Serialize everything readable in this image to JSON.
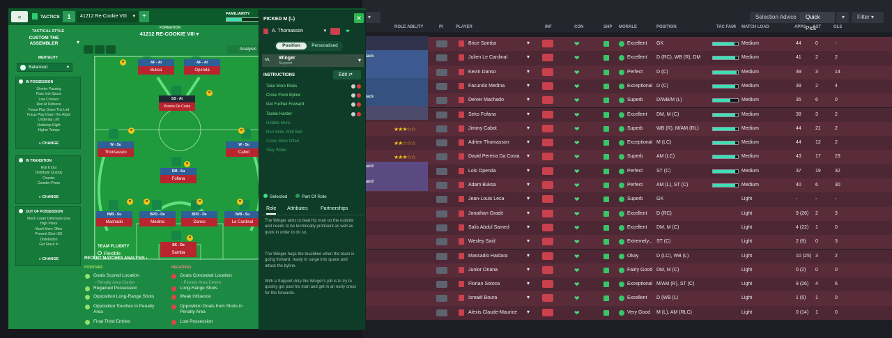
{
  "header": {
    "tactics_label": "TACTICS",
    "slot_number": "1",
    "tactic_name": "41212 Re-Cookie VIII",
    "add_label": "+",
    "familiarity_label": "FAMILIARITY"
  },
  "left_sidebar": {
    "tactical_style_label": "TACTICAL STYLE",
    "tactical_style_value": "CUSTOM THE ASSEMBLER",
    "mentality_label": "MENTALITY",
    "mentality_value": "Balanced",
    "in_possession": {
      "title": "IN POSSESSION",
      "items": [
        "Shorter Passing",
        "Pass Into Space",
        "Low Crosses",
        "Run At Defence",
        "Focus Play Down The Left",
        "Focus Play Down The Right",
        "Underlap Left",
        "Underlap Right",
        "Higher Tempo"
      ],
      "change": "CHANGE"
    },
    "in_transition": {
      "title": "IN TRANSITION",
      "items": [
        "Roll It Out",
        "Distribute Quickly",
        "Counter",
        "Counter-Press"
      ],
      "change": "CHANGE"
    },
    "out_of_possession": {
      "title": "OUT OF POSSESSION",
      "items": [
        "Much Lower Defensive Line",
        "High Press",
        "Much More Often",
        "Prevent Short GK",
        "Distribution",
        "Get Stuck In"
      ],
      "change": "CHANGE"
    }
  },
  "formation": {
    "label": "FORMATION",
    "name": "41212 RE-COOKIE VIII",
    "analysis": "Analysis",
    "team_fluidity_label": "TEAM FLUIDITY",
    "team_fluidity_value": "Flexible",
    "players": [
      {
        "role": "AF - At",
        "name": "Buksa"
      },
      {
        "role": "AF - At",
        "name": "Openda"
      },
      {
        "role": "SS - At",
        "name": "Pereira Da Costa"
      },
      {
        "role": "W - Su",
        "name": "Thomasson"
      },
      {
        "role": "W - Su",
        "name": "Cabot"
      },
      {
        "role": "DM - Su",
        "name": "Fofana"
      },
      {
        "role": "IWB - Su",
        "name": "Machado"
      },
      {
        "role": "BPD - De",
        "name": "Medina"
      },
      {
        "role": "BPD - De",
        "name": "Danso"
      },
      {
        "role": "IWB - Su",
        "name": "Le Cardinal"
      },
      {
        "role": "SK - De",
        "name": "Samba"
      }
    ]
  },
  "analysis": {
    "title": "RECENT MATCHES ANALYSIS",
    "positives_label": "POSITIVES",
    "negatives_label": "NEGATIVES",
    "positives": [
      "Goals Scored Location",
      "- Penalty Area Centre",
      "Regained Possession",
      "Opposition Long-Range Shots",
      "Opposition Touches in Penalty Area",
      "Final Third Entries"
    ],
    "negatives": [
      "Goals Conceded Location",
      "- Penalty Area Centre",
      "Long-Range Shots",
      "Weak Influence",
      "Opposition Goals from Shots in Penalty Area",
      "Lost Possession"
    ]
  },
  "popup": {
    "title": "PICKED M (L)",
    "player": "A. Thomasson",
    "tab_position": "Position",
    "tab_personalised": "Personalised",
    "position_code": "ML",
    "role": "Winger",
    "duty": "Support",
    "instructions_label": "INSTRUCTIONS",
    "edit_label": "Edit",
    "instructions_on": [
      "Take More Risks",
      "Cross From Byline",
      "Get Further Forward",
      "Tackle Harder"
    ],
    "instructions_off": [
      "Dribble More",
      "Run Wide With Ball",
      "Cross More Often",
      "Stay Wider"
    ],
    "legend_selected": "Selected",
    "legend_part": "Part Of Role",
    "tabs": [
      "Role",
      "Attributes",
      "Partnerships"
    ],
    "desc": [
      "The Winger aims to beat his man on the outside and needs to be technically proficient as well as quick in order to do so.",
      "The Winger hugs the touchline when the team is going forward, ready to surge into space and attack the byline.",
      "With a Support duty the Winger's job is to try to quickly get past his man and get in an early cross for the forwards."
    ]
  },
  "squad": {
    "selection_advice": "Selection Advice",
    "quick_pick": "Quick Pick",
    "filter": "Filter",
    "columns": [
      "ROLE ABILITY",
      "PI",
      "PLAYER",
      "INF",
      "CON",
      "SHP",
      "MORALE",
      "POSITION",
      "TAC FAMI",
      "MATCH LOAD",
      "APPS",
      "AST",
      "GLS"
    ],
    "side_labels": [
      "r",
      "Back",
      "Back",
      "ward",
      "ward"
    ],
    "rows": [
      {
        "name": "Brice Samba",
        "morale": "Excellent",
        "pos": "GK",
        "load": "Medium",
        "apps": "44",
        "ast": "0",
        "gls": "-",
        "stars": 3,
        "fam": 0.85,
        "starter": true
      },
      {
        "name": "Julien Le Cardinal",
        "morale": "Excellent",
        "pos": "D (RC), WB (R), DM",
        "load": "Medium",
        "apps": "41",
        "ast": "2",
        "gls": "2",
        "stars": 2,
        "fam": 0.9,
        "starter": true
      },
      {
        "name": "Kevin Danso",
        "morale": "Perfect",
        "pos": "D (C)",
        "load": "Medium",
        "apps": "39",
        "ast": "3",
        "gls": "14",
        "stars": 3,
        "fam": 0.95,
        "starter": true
      },
      {
        "name": "Facundo Medina",
        "morale": "Exceptional",
        "pos": "D (C)",
        "load": "Medium",
        "apps": "39",
        "ast": "2",
        "gls": "4",
        "stars": 3,
        "fam": 0.9,
        "starter": true
      },
      {
        "name": "Deiver Machado",
        "morale": "Superb",
        "pos": "D/WB/M (L)",
        "load": "Medium",
        "apps": "35",
        "ast": "6",
        "gls": "0",
        "stars": 2,
        "fam": 0.7,
        "starter": true
      },
      {
        "name": "Seko Fofana",
        "morale": "Excellent",
        "pos": "DM, M (C)",
        "load": "Medium",
        "apps": "38",
        "ast": "3",
        "gls": "2",
        "stars": 2,
        "fam": 0.9,
        "starter": true
      },
      {
        "name": "Jimmy Cabot",
        "morale": "Superb",
        "pos": "WB (R), M/AM (RL)",
        "load": "Medium",
        "apps": "44",
        "ast": "21",
        "gls": "2",
        "stars": 3,
        "fam": 0.9,
        "starter": true
      },
      {
        "name": "Adrien Thomasson",
        "morale": "Exceptional",
        "pos": "M (LC)",
        "load": "Medium",
        "apps": "44",
        "ast": "12",
        "gls": "2",
        "stars": 2,
        "fam": 0.9,
        "starter": true
      },
      {
        "name": "David Pereira Da Costa",
        "morale": "Superb",
        "pos": "AM (LC)",
        "load": "Medium",
        "apps": "43",
        "ast": "17",
        "gls": "23",
        "stars": 3,
        "fam": 0.9,
        "starter": true
      },
      {
        "name": "Lois Openda",
        "morale": "Perfect",
        "pos": "ST (C)",
        "load": "Medium",
        "apps": "37",
        "ast": "19",
        "gls": "32",
        "stars": 4,
        "fam": 0.9,
        "starter": true
      },
      {
        "name": "Adam Buksa",
        "morale": "Perfect",
        "pos": "AM (L), ST (C)",
        "load": "Medium",
        "apps": "40",
        "ast": "6",
        "gls": "30",
        "stars": 3,
        "fam": 0.9,
        "starter": true
      },
      {
        "name": "Jean-Louis Leca",
        "morale": "Superb",
        "pos": "GK",
        "load": "Light",
        "apps": "-",
        "ast": "-",
        "gls": "-",
        "stars": 0,
        "fam": 0,
        "starter": false
      },
      {
        "name": "Jonathan Gradit",
        "morale": "Excellent",
        "pos": "D (RC)",
        "load": "Light",
        "apps": "9 (26)",
        "ast": "2",
        "gls": "3",
        "stars": 0,
        "fam": 0,
        "starter": false
      },
      {
        "name": "Salis Abdul Samed",
        "morale": "Excellent",
        "pos": "DM, M (C)",
        "load": "Light",
        "apps": "4 (22)",
        "ast": "1",
        "gls": "0",
        "stars": 0,
        "fam": 0,
        "starter": false
      },
      {
        "name": "Wesley Said",
        "morale": "Extremely...",
        "pos": "ST (C)",
        "load": "Light",
        "apps": "2 (9)",
        "ast": "0",
        "gls": "3",
        "stars": 0,
        "fam": 0,
        "starter": false
      },
      {
        "name": "Massadio Haidara",
        "morale": "Okay",
        "pos": "D (LC), WB (L)",
        "load": "Light",
        "apps": "10 (25)",
        "ast": "3",
        "gls": "2",
        "stars": 0,
        "fam": 0,
        "starter": false
      },
      {
        "name": "Junior Onana",
        "morale": "Fairly Good",
        "pos": "DM, M (C)",
        "load": "Light",
        "apps": "0 (2)",
        "ast": "0",
        "gls": "0",
        "stars": 0,
        "fam": 0,
        "starter": false
      },
      {
        "name": "Florian Sotoca",
        "morale": "Exceptional",
        "pos": "M/AM (R), ST (C)",
        "load": "Light",
        "apps": "9 (26)",
        "ast": "4",
        "gls": "6",
        "stars": 0,
        "fam": 0,
        "starter": false
      },
      {
        "name": "Ismaël Boura",
        "morale": "Excellent",
        "pos": "D (WB (L)",
        "load": "Light",
        "apps": "1 (5)",
        "ast": "1",
        "gls": "0",
        "stars": 0,
        "fam": 0,
        "starter": false
      },
      {
        "name": "Alexis Claude-Maurice",
        "morale": "Very Good",
        "pos": "M (L), AM (RLC)",
        "load": "Light",
        "apps": "0 (14)",
        "ast": "1",
        "gls": "0",
        "stars": 0,
        "fam": 0,
        "starter": false
      }
    ]
  },
  "colors": {
    "accent": "#1d8a43",
    "dark_green": "#0f3c28",
    "row_red": "#5a2c3a",
    "highlight": "#7be38f"
  }
}
